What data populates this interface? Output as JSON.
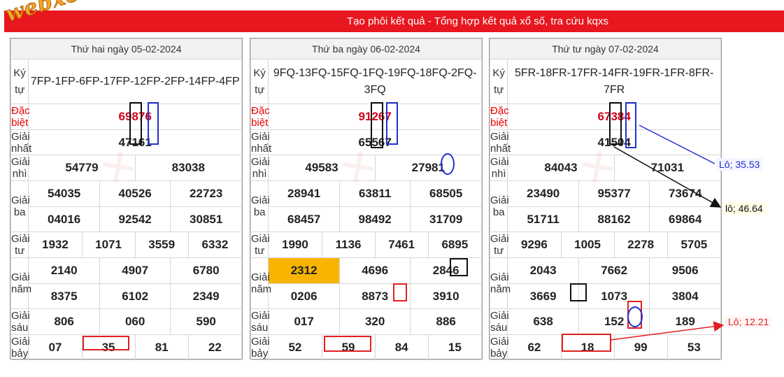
{
  "header": {
    "title": "Tạo phôi kết quả - Tổng hợp kết quả xổ số, tra cứu kqxs",
    "logo": "webxoso.net"
  },
  "labels": {
    "kytu": "Ký tự",
    "db": "Đặc biệt",
    "g1": "Giải nhất",
    "g2": "Giải nhì",
    "g3": "Giải ba",
    "g4": "Giải tư",
    "g5": "Giải năm",
    "g6": "Giải sáu",
    "g7": "Giải bảy"
  },
  "panels": [
    {
      "date": "Thứ hai ngày 05-02-2024",
      "kytu": "7FP-1FP-6FP-17FP-12FP-2FP-14FP-4FP",
      "db": "69876",
      "g1": "47161",
      "g2": [
        "54779",
        "83038"
      ],
      "g3": [
        "54035",
        "40526",
        "22723",
        "04016",
        "92542",
        "30851"
      ],
      "g4": [
        "1932",
        "1071",
        "3559",
        "6332"
      ],
      "g5": [
        "2140",
        "4907",
        "6780",
        "8375",
        "6102",
        "2349"
      ],
      "g6": [
        "806",
        "060",
        "590"
      ],
      "g7": [
        "07",
        "35",
        "81",
        "22"
      ]
    },
    {
      "date": "Thứ ba ngày 06-02-2024",
      "kytu": "9FQ-13FQ-15FQ-1FQ-19FQ-18FQ-2FQ-3FQ",
      "db": "91267",
      "g1": "65567",
      "g2": [
        "49583",
        "27981"
      ],
      "g3": [
        "28941",
        "63811",
        "68505",
        "68457",
        "98492",
        "31709"
      ],
      "g4": [
        "1990",
        "1136",
        "7461",
        "6895"
      ],
      "g5": [
        "2312",
        "4696",
        "2846",
        "0206",
        "8873",
        "3910"
      ],
      "g6": [
        "017",
        "320",
        "886"
      ],
      "g7": [
        "52",
        "59",
        "84",
        "15"
      ]
    },
    {
      "date": "Thứ tư ngày 07-02-2024",
      "kytu": "5FR-18FR-17FR-14FR-19FR-1FR-8FR-7FR",
      "db": "67384",
      "g1": "41504",
      "g2": [
        "84043",
        "71031"
      ],
      "g3": [
        "23490",
        "95377",
        "73674",
        "51711",
        "88162",
        "69864"
      ],
      "g4": [
        "9296",
        "1005",
        "2278",
        "5705"
      ],
      "g5": [
        "2043",
        "7662",
        "9506",
        "3669",
        "1073",
        "3804"
      ],
      "g6": [
        "638",
        "152",
        "189"
      ],
      "g7": [
        "62",
        "18",
        "99",
        "53"
      ]
    }
  ],
  "annotations": {
    "lo1": "Lô; 35.53",
    "lo2": "lô; 46.64",
    "lo3": "Lô; 12.21"
  },
  "colors": {
    "brand": "#e8161e",
    "highlight": "#f8b400",
    "special": "#d0021b"
  }
}
